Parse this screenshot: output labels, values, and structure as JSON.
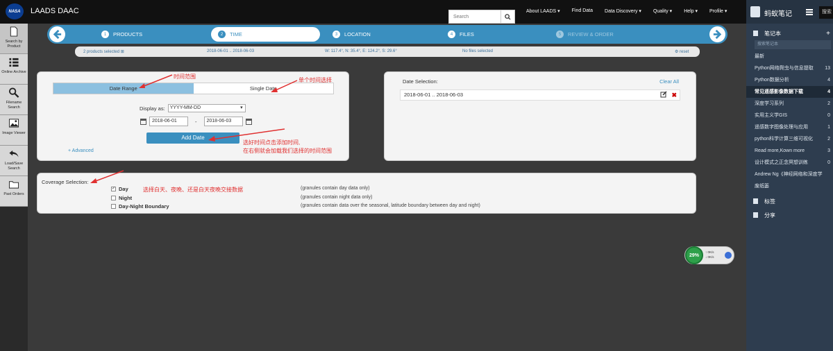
{
  "header": {
    "logo_text": "NASA",
    "app_title": "LAADS DAAC",
    "search_placeholder": "Search",
    "nav": [
      "About LAADS ▾",
      "Find Data",
      "Data Discovery ▾",
      "Quality ▾",
      "Help ▾",
      "Profile ▾"
    ]
  },
  "left_rail": [
    {
      "label": "Search by Product",
      "icon": "file-icon"
    },
    {
      "label": "Online Archive",
      "icon": "list-icon"
    },
    {
      "label": "Filename Search",
      "icon": "search-icon"
    },
    {
      "label": "Image Viewer",
      "icon": "image-icon"
    },
    {
      "label": "Load/Save Search",
      "icon": "back-arrow-icon"
    },
    {
      "label": "Past Orders",
      "icon": "folder-icon"
    }
  ],
  "wizard": {
    "steps": [
      {
        "num": "1",
        "label": "PRODUCTS"
      },
      {
        "num": "2",
        "label": "TIME"
      },
      {
        "num": "3",
        "label": "LOCATION"
      },
      {
        "num": "4",
        "label": "FILES"
      },
      {
        "num": "5",
        "label": "REVIEW & ORDER"
      }
    ]
  },
  "summary": {
    "products": "2 products selected ⊞",
    "dates": "2018-06-01 .. 2018-06-03",
    "bbox": "W: 117.4°, N: 35.4°, E: 124.2°, S: 29.6°",
    "files": "No files selected",
    "reset": "⚙ reset"
  },
  "date_panel": {
    "tab_range": "Date Range",
    "tab_single": "Single Date",
    "display_as_label": "Display as:",
    "display_as_value": "YYYY-MM-DD",
    "start_date": "2018-06-01",
    "end_date": "2018-06-03",
    "dash": "-",
    "add_button": "Add Date",
    "advanced": "+ Advanced"
  },
  "annotations": {
    "time_range": "时间范围",
    "single_time": "单个时间选择",
    "add_note_1": "选好时间点击添加时间,",
    "add_note_2": "在右侧就会加载我们选择的时间范围",
    "coverage_note": "选择白天、夜晚、还是白天夜晚交接数据"
  },
  "selection_panel": {
    "label": "Date Selection:",
    "clear_all": "Clear All",
    "entry": "2018-06-01 .. 2018-06-03"
  },
  "coverage": {
    "label": "Coverage Selection:",
    "options": [
      {
        "name": "Day",
        "checked": true,
        "desc": "(granules contain day data only)"
      },
      {
        "name": "Night",
        "checked": false,
        "desc": "(granules contain night data only)"
      },
      {
        "name": "Day-Night Boundary",
        "checked": false,
        "desc": "(granules contain data over the seasonal, latitude boundary between day and night)"
      }
    ]
  },
  "speed_widget": {
    "percent": "29%",
    "up": "↑ 0K/s",
    "down": "↓ 0K/s"
  },
  "notes_app": {
    "title": "蚂蚁笔记",
    "search": "搜索",
    "notebook_section": "笔记本",
    "search_notebook_placeholder": "搜索笔记本",
    "items": [
      {
        "name": "最新",
        "count": ""
      },
      {
        "name": "Python网络爬虫与信息提取",
        "count": "13"
      },
      {
        "name": "Python数据分析",
        "count": "4"
      },
      {
        "name": "常见遥感影像数据下载",
        "count": "4"
      },
      {
        "name": "深度学习系列",
        "count": "2"
      },
      {
        "name": "实用主义学GIS",
        "count": "0"
      },
      {
        "name": "遥感数字图像处理与应用",
        "count": "1"
      },
      {
        "name": "python科学计算三维可视化",
        "count": "2"
      },
      {
        "name": "Read more,Kown more",
        "count": "3"
      },
      {
        "name": "设计模式之正念冥想训练",
        "count": "0"
      },
      {
        "name": "Andrew Ng《神经网络和深度学",
        "count": ""
      },
      {
        "name": "废纸篓",
        "count": ""
      }
    ],
    "tags_section": "标签",
    "share_section": "分享"
  }
}
